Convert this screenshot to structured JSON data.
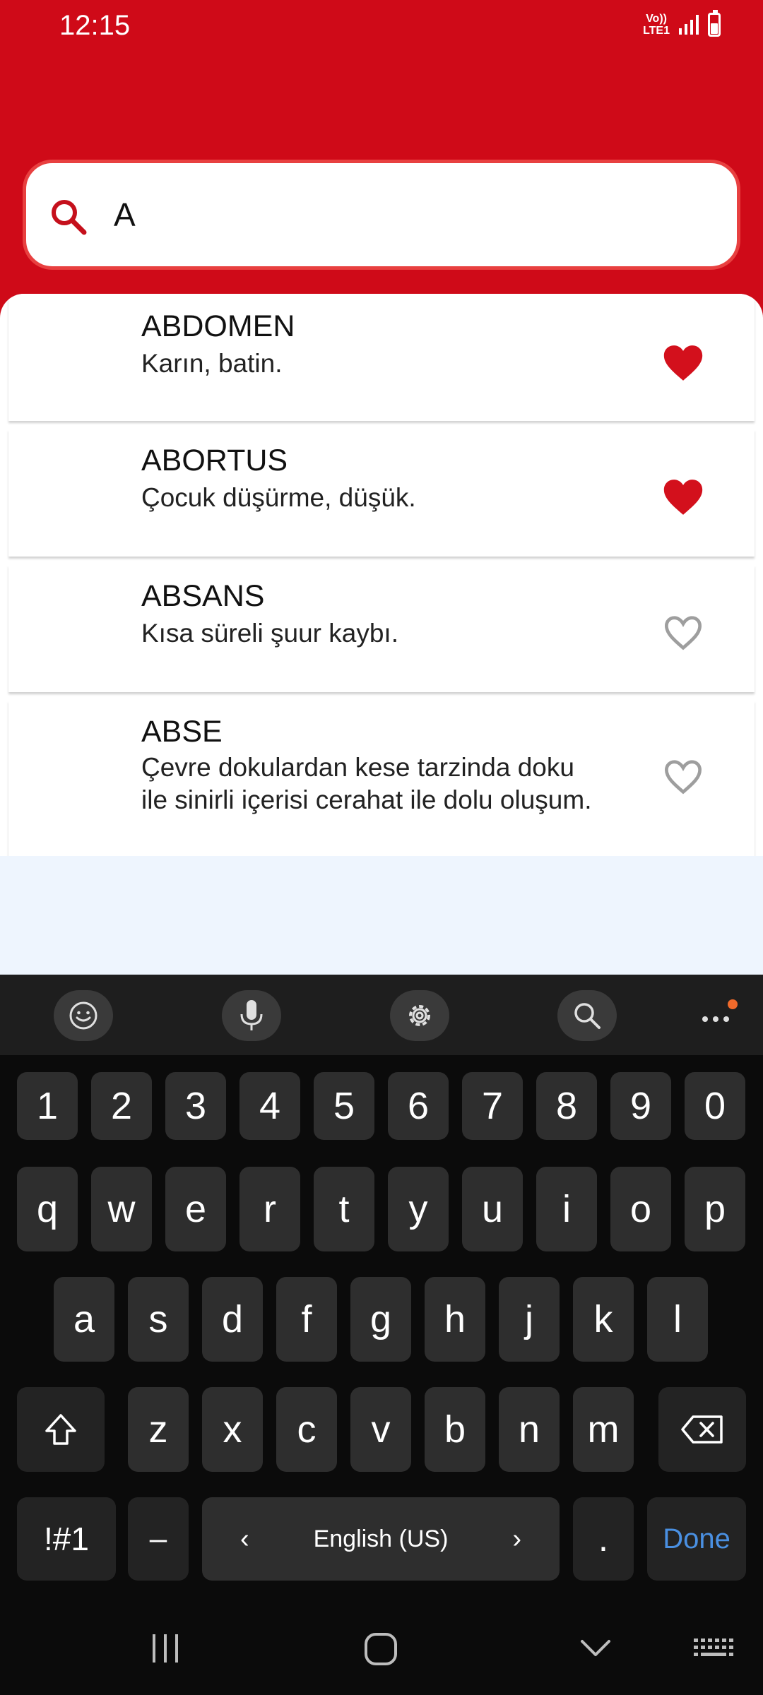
{
  "status_bar": {
    "time": "12:15",
    "network": "Vo)) LTE1"
  },
  "search": {
    "value": "A"
  },
  "results": [
    {
      "term": "ABDOMEN",
      "definition": " Karın, batin.",
      "favorite": true
    },
    {
      "term": "ABORTUS",
      "definition": " Çocuk düşürme, düşük.",
      "favorite": true
    },
    {
      "term": "ABSANS",
      "definition": " Kısa süreli şuur kaybı.",
      "favorite": false
    },
    {
      "term": "ABSE",
      "definition": " Çevre dokulardan kese tarzinda doku ile sinirli içerisi cerahat ile dolu oluşum.",
      "favorite": false
    }
  ],
  "colors": {
    "header": "#cf0a18",
    "heart_active": "#d3101c",
    "heart_inactive": "#9e9e9e",
    "done": "#4a90e2"
  },
  "keyboard": {
    "toolbar": [
      "emoji-icon",
      "microphone-icon",
      "settings-icon",
      "search-icon",
      "more-icon"
    ],
    "row_numbers": [
      "1",
      "2",
      "3",
      "4",
      "5",
      "6",
      "7",
      "8",
      "9",
      "0"
    ],
    "row_1": [
      "q",
      "w",
      "e",
      "r",
      "t",
      "y",
      "u",
      "i",
      "o",
      "p"
    ],
    "row_2": [
      "a",
      "s",
      "d",
      "f",
      "g",
      "h",
      "j",
      "k",
      "l"
    ],
    "row_3": [
      "z",
      "x",
      "c",
      "v",
      "b",
      "n",
      "m"
    ],
    "symbols_label": "!#1",
    "dash_label": "–",
    "space_label": "English (US)",
    "period_label": ".",
    "done_label": "Done"
  },
  "nav_bar": [
    "recents-icon",
    "home-icon",
    "back-icon",
    "keyboard-switch-icon"
  ]
}
